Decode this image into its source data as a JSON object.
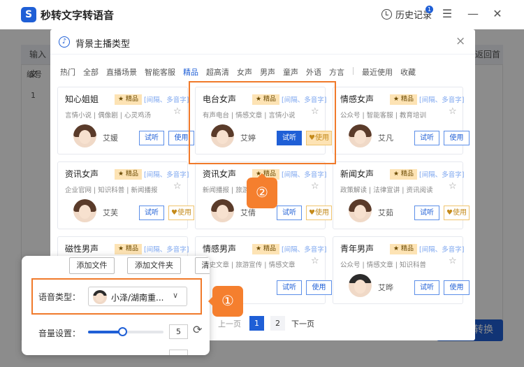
{
  "app": {
    "title": "秒转文字转语音",
    "logo": "S",
    "history": "历史记录",
    "history_badge": "1"
  },
  "window_controls": [
    "☰",
    "—",
    "✕"
  ],
  "background": {
    "input_tab": "输入文",
    "col_header": "编号",
    "row_num": "1",
    "back_home": "返回首页",
    "convert_button": "开始转换"
  },
  "modal": {
    "title": "背景主播类型",
    "close": "×",
    "categories": [
      "热门",
      "全部",
      "直播场景",
      "智能客服",
      "精品",
      "超高清",
      "女声",
      "男声",
      "童声",
      "外语",
      "方言"
    ],
    "extra_categories": [
      "最近使用",
      "收藏"
    ],
    "active_category": "精品",
    "listen_label": "试听",
    "use_label": "使用",
    "tag_label": "★ 精品",
    "feature_label": "[间隔、多音字]",
    "cards": [
      {
        "name": "知心姐姐",
        "sub": "言情小说 | 偶像剧 | 心灵鸡汤",
        "person": "艾媛",
        "use_vip": false,
        "avatar": "female"
      },
      {
        "name": "电台女声",
        "sub": "有声电台 | 情感文章 | 言情小说",
        "person": "艾婷",
        "use_vip": true,
        "avatar": "female",
        "selected": true
      },
      {
        "name": "情感女声",
        "sub": "公众号 | 智能客服 | 教育培训",
        "person": "艾凡",
        "use_vip": false,
        "avatar": "female"
      },
      {
        "name": "资讯女声",
        "sub": "企业官网 | 知识科普 | 新闻播报",
        "person": "艾芙",
        "use_vip": true,
        "avatar": "female"
      },
      {
        "name": "资讯女声",
        "sub": "新闻播报 | 旅游宣传",
        "person": "艾倩",
        "use_vip": true,
        "avatar": "female"
      },
      {
        "name": "新闻女声",
        "sub": "政策解读 | 法律宣讲 | 资讯阅读",
        "person": "艾茹",
        "use_vip": true,
        "avatar": "female"
      },
      {
        "name": "磁性男声",
        "sub": "",
        "person": "",
        "use_vip": false,
        "avatar": "male"
      },
      {
        "name": "情感男声",
        "sub": "历史文章 | 旅游宣传 | 情感文章",
        "person": "",
        "use_vip": false,
        "avatar": "male"
      },
      {
        "name": "青年男声",
        "sub": "公众号 | 情感文章 | 知识科普",
        "person": "艾晔",
        "use_vip": false,
        "avatar": "male"
      }
    ],
    "pagination": {
      "prev": "上一页",
      "pages": [
        "1",
        "2"
      ],
      "current": "1",
      "next": "下一页"
    }
  },
  "panel": {
    "add_file": "添加文件",
    "add_folder": "添加文件夹",
    "clear": "清",
    "voice_label": "语音类型：",
    "voice_value": "小泽/湖南重...",
    "volume_label": "音量设置：",
    "volume_value": "5",
    "volume_fraction": 0.45
  },
  "markers": {
    "one": "①",
    "two": "②"
  }
}
